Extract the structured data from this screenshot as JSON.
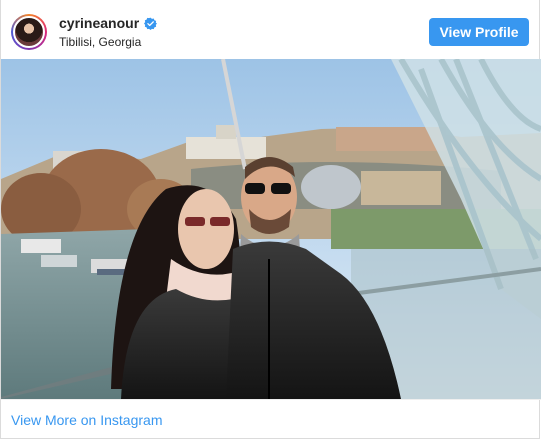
{
  "post": {
    "username": "cyrineanour",
    "location": "Tibilisi, Georgia",
    "view_profile_label": "View Profile",
    "view_more_label": "View More on Instagram",
    "photo_alt": "cyrineanour"
  },
  "icons": {
    "verified": "verified-badge-icon",
    "avatar": "profile-avatar"
  },
  "colors": {
    "accent": "#3897f0",
    "verified": "#3897f0",
    "text": "#262626"
  }
}
